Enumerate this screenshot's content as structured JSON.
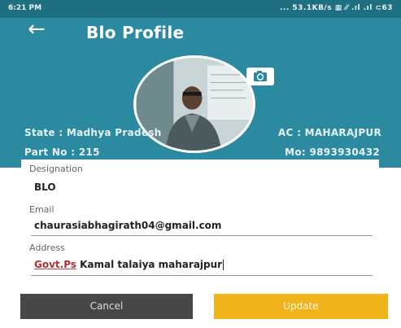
{
  "status_bar": {
    "time": "6:21 PM",
    "right": "... 53.1KB/s ▦ ⁄⁄ .ıl .ıl ⊂63"
  },
  "header": {
    "title": "Blo Profile",
    "back_icon": "arrow-left-icon",
    "camera_icon": "camera-switch-icon"
  },
  "profile": {
    "state": "State : Madhya Pradesh",
    "ac": "AC : MAHARAJPUR",
    "part_no": "Part No : 215",
    "mobile": "Mo: 9893930432"
  },
  "form": {
    "designation_label": "Designation",
    "designation_value": "BLO",
    "email_label": "Email",
    "email_value": "chaurasiabhagirath04@gmail.com",
    "address_label": "Address",
    "address_value_prefix": "Govt.Ps",
    "address_value_rest": " Kamal talaiya maharajpur"
  },
  "buttons": {
    "cancel": "Cancel",
    "update": "Update"
  },
  "colors": {
    "header": "#2b8aa0",
    "status_bar": "#1e6f81",
    "cancel_button": "#464646",
    "update_button": "#f1b31a"
  }
}
